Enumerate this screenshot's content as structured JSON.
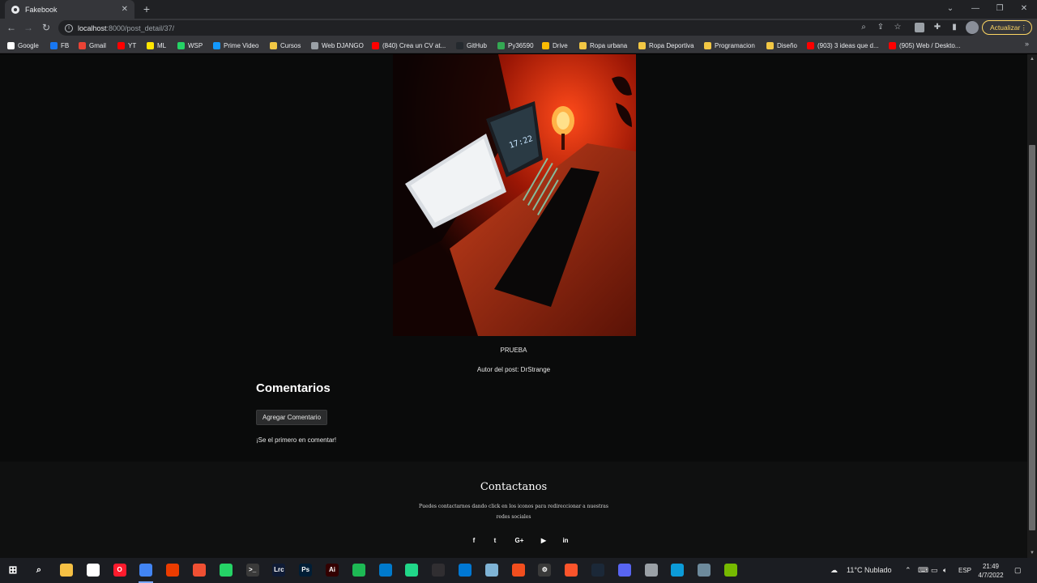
{
  "browser": {
    "tab_title": "Fakebook",
    "tab_close": "✕",
    "new_tab": "+",
    "url_host": "localhost",
    "url_path": ":8000/post_detail/37/",
    "update_button": "Actualizar",
    "window_controls": [
      "⌄",
      "—",
      "❐",
      "✕"
    ]
  },
  "bookmarks": [
    {
      "label": "Google",
      "color": "#ffffff"
    },
    {
      "label": "FB",
      "color": "#1877f2"
    },
    {
      "label": "Gmail",
      "color": "#ea4335"
    },
    {
      "label": "YT",
      "color": "#ff0000"
    },
    {
      "label": "ML",
      "color": "#ffe600"
    },
    {
      "label": "WSP",
      "color": "#25d366"
    },
    {
      "label": "Prime Video",
      "color": "#1399ff"
    },
    {
      "label": "Cursos",
      "color": "#f2c744"
    },
    {
      "label": "Web DJANGO",
      "color": "#9aa0a6"
    },
    {
      "label": "(840) Crea un CV at...",
      "color": "#ff0000"
    },
    {
      "label": "GitHub",
      "color": "#24292e"
    },
    {
      "label": "Py36590",
      "color": "#34a853"
    },
    {
      "label": "Drive",
      "color": "#fbbc04"
    },
    {
      "label": "Ropa urbana",
      "color": "#f2c744"
    },
    {
      "label": "Ropa Deportiva",
      "color": "#f2c744"
    },
    {
      "label": "Programacion",
      "color": "#f2c744"
    },
    {
      "label": "Diseño",
      "color": "#f2c744"
    },
    {
      "label": "(903) 3 ideas que d...",
      "color": "#ff0000"
    },
    {
      "label": "(905) Web / Deskto...",
      "color": "#ff0000"
    }
  ],
  "bookmarks_more": "»",
  "post": {
    "title": "PRUEBA",
    "author": "Autor del post: DrStrange",
    "photo_clock": "17:22"
  },
  "comments": {
    "heading": "Comentarios",
    "add_button": "Agregar Comentario",
    "empty_text": "¡Se el primero en comentar!"
  },
  "footer": {
    "title": "Contactanos",
    "text": "Puedes contactarnos dando click en los iconos para redireccionar a nuestras redes sociales",
    "social": [
      {
        "name": "facebook",
        "glyph": "f"
      },
      {
        "name": "twitter",
        "glyph": "t"
      },
      {
        "name": "google-plus",
        "glyph": "G+"
      },
      {
        "name": "youtube",
        "glyph": "▶"
      },
      {
        "name": "linkedin",
        "glyph": "in"
      }
    ]
  },
  "taskbar": {
    "weather": "11°C  Nublado",
    "language": "ESP",
    "time": "21:49",
    "date": "4/7/2022",
    "apps": [
      {
        "name": "file-explorer",
        "color": "#f5c044",
        "glyph": ""
      },
      {
        "name": "store",
        "color": "#ffffff",
        "glyph": ""
      },
      {
        "name": "opera",
        "color": "#ff1b2d",
        "glyph": "O"
      },
      {
        "name": "chrome",
        "color": "#4285f4",
        "glyph": ""
      },
      {
        "name": "office",
        "color": "#eb3c00",
        "glyph": ""
      },
      {
        "name": "git",
        "color": "#f05033",
        "glyph": ""
      },
      {
        "name": "whatsapp",
        "color": "#25d366",
        "glyph": ""
      },
      {
        "name": "terminal",
        "color": "#3a3a3a",
        "glyph": ">_"
      },
      {
        "name": "lightroom",
        "color": "#0f1b35",
        "glyph": "Lrc"
      },
      {
        "name": "photoshop",
        "color": "#001e36",
        "glyph": "Ps"
      },
      {
        "name": "illustrator",
        "color": "#330000",
        "glyph": "Ai"
      },
      {
        "name": "spotify",
        "color": "#1db954",
        "glyph": ""
      },
      {
        "name": "vscode",
        "color": "#007acc",
        "glyph": ""
      },
      {
        "name": "pycharm",
        "color": "#21d789",
        "glyph": ""
      },
      {
        "name": "obs",
        "color": "#302e31",
        "glyph": ""
      },
      {
        "name": "outlook",
        "color": "#0078d4",
        "glyph": ""
      },
      {
        "name": "notes",
        "color": "#7fb3d5",
        "glyph": ""
      },
      {
        "name": "figma",
        "color": "#f24e1e",
        "glyph": ""
      },
      {
        "name": "settings",
        "color": "#3a3a3a",
        "glyph": "⚙"
      },
      {
        "name": "brave",
        "color": "#fb542b",
        "glyph": ""
      },
      {
        "name": "steam",
        "color": "#1b2838",
        "glyph": ""
      },
      {
        "name": "discord",
        "color": "#5865f2",
        "glyph": ""
      },
      {
        "name": "database",
        "color": "#9aa0a6",
        "glyph": ""
      },
      {
        "name": "edge",
        "color": "#0c9bd8",
        "glyph": ""
      },
      {
        "name": "tool",
        "color": "#6d8a9c",
        "glyph": ""
      },
      {
        "name": "nvidia",
        "color": "#76b900",
        "glyph": ""
      }
    ]
  }
}
